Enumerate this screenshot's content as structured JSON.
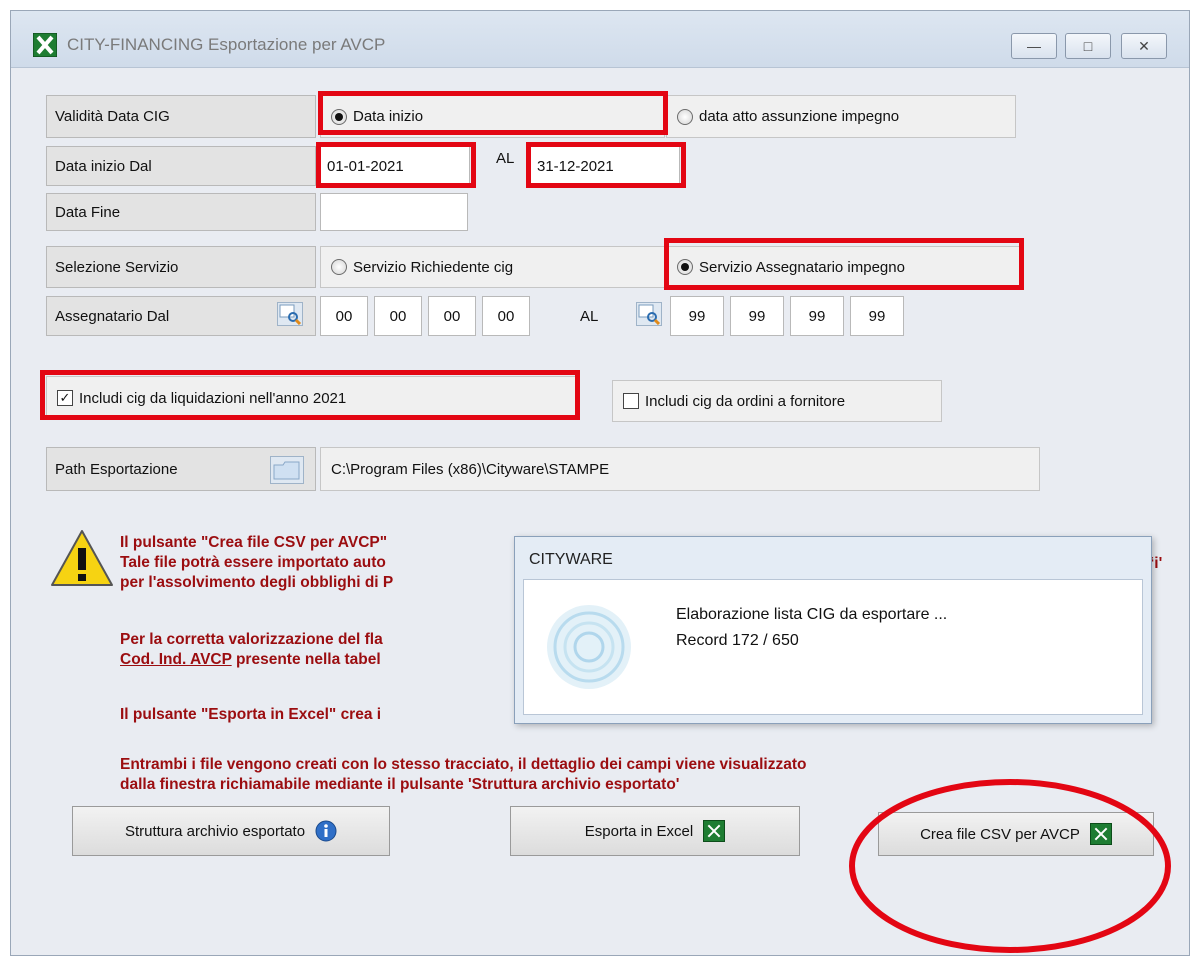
{
  "window": {
    "title": "CITY-FINANCING Esportazione per AVCP",
    "buttons": {
      "minimize": "—",
      "maximize": "□",
      "close": "✕"
    }
  },
  "validita": {
    "label": "Validità  Data CIG",
    "option1": "Data inizio",
    "option2": "data atto assunzione impegno",
    "selected": "option1"
  },
  "data_inizio": {
    "label": "Data inizio Dal",
    "from": "01-01-2021",
    "al": "AL",
    "to": "31-12-2021"
  },
  "data_fine": {
    "label": "Data Fine",
    "value": ""
  },
  "servizio": {
    "label": "Selezione Servizio",
    "option1": "Servizio Richiedente cig",
    "option2": "Servizio Assegnatario  impegno",
    "selected": "option2"
  },
  "assegnatario": {
    "label": "Assegnatario Dal",
    "from": [
      "00",
      "00",
      "00",
      "00"
    ],
    "al": "AL",
    "to": [
      "99",
      "99",
      "99",
      "99"
    ]
  },
  "checks": {
    "liquidazioni": {
      "label": "Includi cig da liquidazioni nell'anno 2021",
      "checked": true
    },
    "ordini": {
      "label": "Includi cig da ordini a fornitore",
      "checked": false
    }
  },
  "path": {
    "label": "Path Esportazione",
    "value": "C:\\Program Files (x86)\\Cityware\\STAMPE"
  },
  "messages": {
    "p1_l1": "Il pulsante \"Crea file CSV per AVCP\"",
    "p1_l1_tail": "‘i'",
    "p1_l2": "Tale file potrà essere importato auto",
    "p1_l3": "per l'assolvimento degli obblighi di P",
    "p2_l1": "Per la corretta valorizzazione del fla",
    "p2_l2a": "Cod. Ind. AVCP",
    "p2_l2b": " presente nella tabel",
    "p3_l1": "Il pulsante \"Esporta in Excel\" crea i",
    "p4_l1": "Entrambi i file vengono creati con lo stesso tracciato, il dettaglio dei campi viene visualizzato",
    "p4_l2": "dalla finestra richiamabile mediante il pulsante 'Struttura archivio esportato'"
  },
  "buttons": {
    "struttura": "Struttura archivio esportato",
    "excel": "Esporta in Excel",
    "csv": "Crea file CSV per AVCP"
  },
  "popup": {
    "title": "CITYWARE",
    "line1": "Elaborazione lista CIG da esportare ...",
    "line2": "Record  172 / 650"
  },
  "colors": {
    "highlight": "#e30613",
    "message_text": "#9b0d10"
  }
}
